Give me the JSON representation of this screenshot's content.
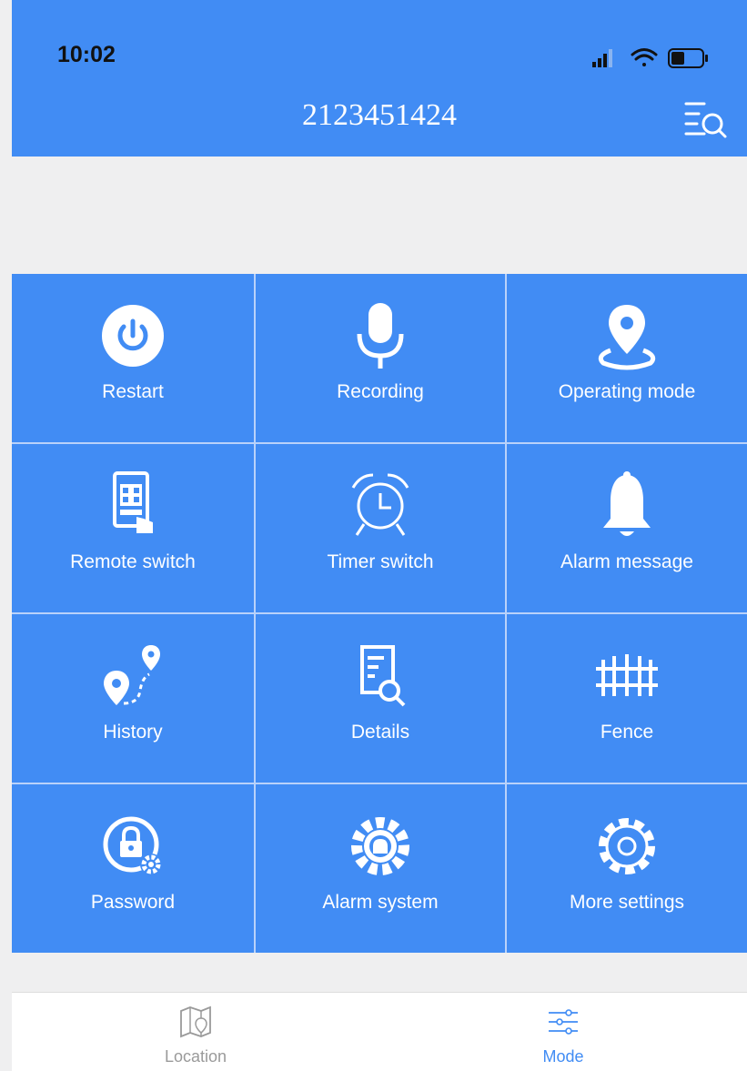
{
  "status_bar": {
    "time": "10:02"
  },
  "header": {
    "title": "2123451424"
  },
  "grid": [
    {
      "label": "Restart",
      "icon": "power-icon"
    },
    {
      "label": "Recording",
      "icon": "microphone-icon"
    },
    {
      "label": "Operating mode",
      "icon": "location-pin-icon"
    },
    {
      "label": "Remote switch",
      "icon": "remote-keypad-icon"
    },
    {
      "label": "Timer switch",
      "icon": "alarm-clock-icon"
    },
    {
      "label": "Alarm message",
      "icon": "bell-icon"
    },
    {
      "label": "History",
      "icon": "route-history-icon"
    },
    {
      "label": "Details",
      "icon": "document-search-icon"
    },
    {
      "label": "Fence",
      "icon": "fence-icon"
    },
    {
      "label": "Password",
      "icon": "lock-gear-icon"
    },
    {
      "label": "Alarm system",
      "icon": "alarm-gear-icon"
    },
    {
      "label": "More settings",
      "icon": "settings-gear-icon"
    }
  ],
  "tabs": [
    {
      "label": "Location",
      "icon": "map-icon",
      "active": false
    },
    {
      "label": "Mode",
      "icon": "sliders-icon",
      "active": true
    }
  ],
  "colors": {
    "primary": "#418cf4",
    "divider": "#b9d2fa",
    "inactive_tab": "#9a9a9a"
  }
}
